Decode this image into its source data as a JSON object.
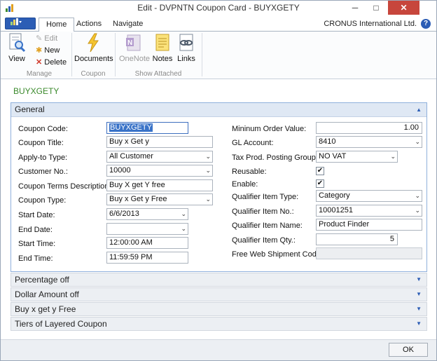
{
  "window": {
    "title": "Edit - DVPNTN Coupon Card - BUYXGETY",
    "minimize": "─",
    "maximize": "□",
    "close": "✕"
  },
  "tabs": [
    "Home",
    "Actions",
    "Navigate"
  ],
  "company": "CRONUS International Ltd.",
  "help": "?",
  "ribbon": {
    "manage": {
      "view": "View",
      "edit": "Edit",
      "new": "New",
      "delete": "Delete",
      "group": "Manage"
    },
    "coupon": {
      "documents": "Documents",
      "group": "Coupon"
    },
    "show_attached": {
      "onenote": "OneNote",
      "notes": "Notes",
      "links": "Links",
      "group": "Show Attached"
    }
  },
  "page_title": "BUYXGETY",
  "general": {
    "header": "General",
    "left": {
      "coupon_code": {
        "label": "Coupon Code:",
        "value": "BUYXGETY"
      },
      "coupon_title": {
        "label": "Coupon Title:",
        "value": "Buy x Get y"
      },
      "apply_to_type": {
        "label": "Apply-to Type:",
        "value": "All Customer"
      },
      "customer_no": {
        "label": "Customer No.:",
        "value": "10000"
      },
      "terms": {
        "label": "Coupon Terms Description:",
        "value": "Buy X get Y free"
      },
      "coupon_type": {
        "label": "Coupon Type:",
        "value": "Buy x Get y Free"
      },
      "start_date": {
        "label": "Start Date:",
        "value": "6/6/2013"
      },
      "end_date": {
        "label": "End Date:",
        "value": ""
      },
      "start_time": {
        "label": "Start Time:",
        "value": "12:00:00 AM"
      },
      "end_time": {
        "label": "End Time:",
        "value": "11:59:59 PM"
      }
    },
    "right": {
      "min_order": {
        "label": "Mininum Order Value:",
        "value": "1.00"
      },
      "gl_account": {
        "label": "GL Account:",
        "value": "8410"
      },
      "tax_group": {
        "label": "Tax Prod. Posting Group:",
        "value": "NO VAT"
      },
      "reusable": {
        "label": "Reusable:",
        "checked": true
      },
      "enable": {
        "label": "Enable:",
        "checked": true
      },
      "qualifier_type": {
        "label": "Qualifier Item Type:",
        "value": "Category"
      },
      "qualifier_no": {
        "label": "Qualifier Item No.:",
        "value": "10001251"
      },
      "qualifier_name": {
        "label": "Qualifier Item  Name:",
        "value": "Product Finder"
      },
      "qualifier_qty": {
        "label": "Qualifier Item Qty.:",
        "value": "5"
      },
      "free_web_ship": {
        "label": "Free Web Shipment Code:",
        "value": ""
      }
    }
  },
  "fasttabs": [
    "Percentage off",
    "Dollar Amount off",
    "Buy x get y Free",
    "Tiers of Layered Coupon"
  ],
  "icons": {
    "expand": "▲",
    "collapse": "▼",
    "dropdown": "⌄",
    "checkmark": "✔"
  },
  "ok_label": "OK"
}
